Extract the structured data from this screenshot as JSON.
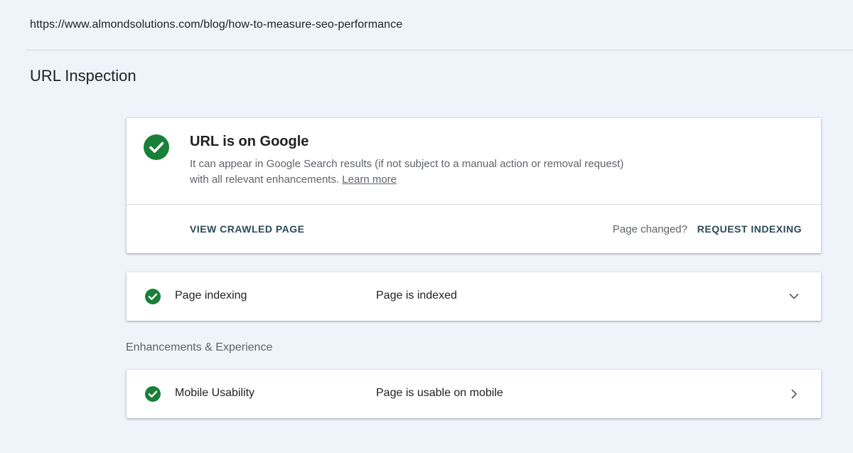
{
  "url": "https://www.almondsolutions.com/blog/how-to-measure-seo-performance",
  "page_title": "URL Inspection",
  "status_card": {
    "title": "URL is on Google",
    "description": "It can appear in Google Search results (if not subject to a manual action or removal request) with all relevant enhancements.",
    "learn_more": "Learn more",
    "view_crawled_page": "VIEW CRAWLED PAGE",
    "page_changed": "Page changed?",
    "request_indexing": "REQUEST INDEXING"
  },
  "indexing": {
    "label": "Page indexing",
    "value": "Page is indexed"
  },
  "enhancements_header": "Enhancements & Experience",
  "mobile_usability": {
    "label": "Mobile Usability",
    "value": "Page is usable on mobile"
  },
  "colors": {
    "background": "#eff4fb",
    "success": "#188038",
    "action_text": "#2b4a57"
  },
  "icons": {
    "status": "check-circle-icon",
    "expand": "chevron-down-icon",
    "navigate": "chevron-right-icon"
  }
}
